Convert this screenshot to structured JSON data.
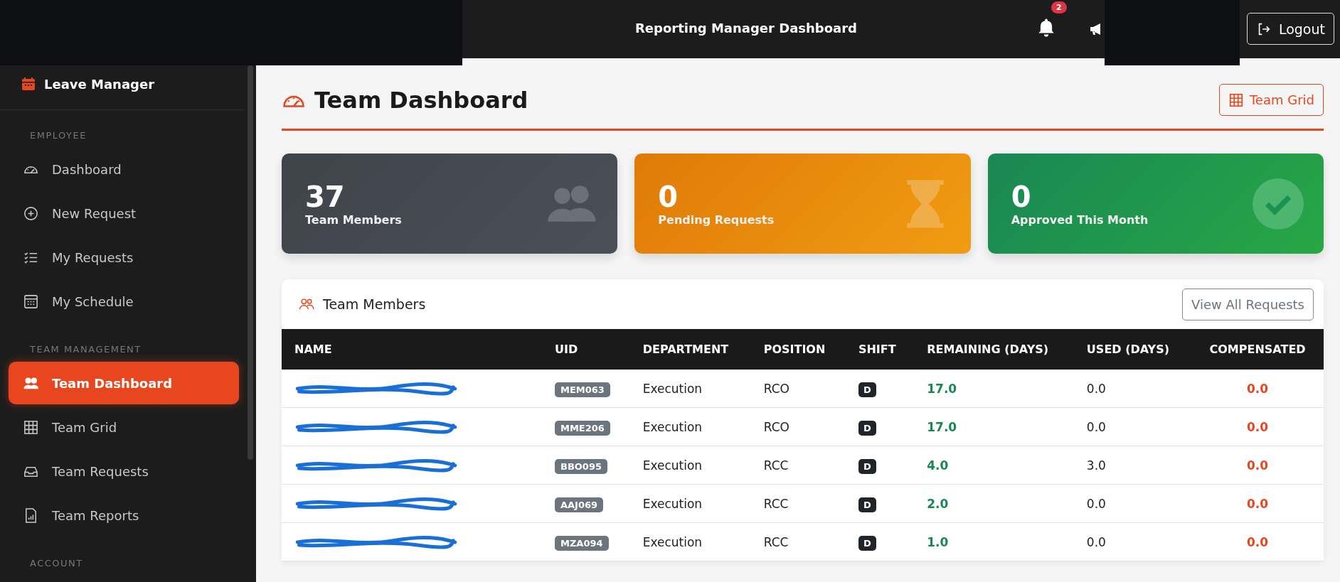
{
  "topbar": {
    "title": "Reporting Manager Dashboard",
    "notification_count": "2",
    "logout": "Logout"
  },
  "sidebar": {
    "brand": "Leave Manager",
    "sections": [
      {
        "heading": "EMPLOYEE",
        "items": [
          {
            "label": "Dashboard",
            "kind": "gauge",
            "selected": false
          },
          {
            "label": "New Request",
            "kind": "plus",
            "selected": false
          },
          {
            "label": "My Requests",
            "kind": "list",
            "selected": false
          },
          {
            "label": "My Schedule",
            "kind": "calendar",
            "selected": false
          }
        ]
      },
      {
        "heading": "TEAM MANAGEMENT",
        "items": [
          {
            "label": "Team Dashboard",
            "kind": "people",
            "selected": true
          },
          {
            "label": "Team Grid",
            "kind": "grid",
            "selected": false
          },
          {
            "label": "Team Requests",
            "kind": "inbox",
            "selected": false
          },
          {
            "label": "Team Reports",
            "kind": "report",
            "selected": false
          }
        ]
      },
      {
        "heading": "ACCOUNT"
      }
    ]
  },
  "page": {
    "title": "Team Dashboard",
    "action": "Team Grid"
  },
  "stats": [
    {
      "value": "37",
      "label": "Team Members",
      "kind": "members"
    },
    {
      "value": "0",
      "label": "Pending Requests",
      "kind": "pending"
    },
    {
      "value": "0",
      "label": "Approved This Month",
      "kind": "approved"
    }
  ],
  "team_panel": {
    "title": "Team Members",
    "action": "View All Requests",
    "columns": [
      "NAME",
      "UID",
      "DEPARTMENT",
      "POSITION",
      "SHIFT",
      "REMAINING (DAYS)",
      "USED (DAYS)",
      "COMPENSATED"
    ],
    "rows": [
      {
        "name_redacted": true,
        "uid": "MEM063",
        "department": "Execution",
        "position": "RCO",
        "shift": "D",
        "remaining": "17.0",
        "used": "0.0",
        "compensated": "0.0"
      },
      {
        "name_redacted": true,
        "uid": "MME206",
        "department": "Execution",
        "position": "RCO",
        "shift": "D",
        "remaining": "17.0",
        "used": "0.0",
        "compensated": "0.0"
      },
      {
        "name_redacted": true,
        "uid": "BBO095",
        "department": "Execution",
        "position": "RCC",
        "shift": "D",
        "remaining": "4.0",
        "used": "3.0",
        "compensated": "0.0"
      },
      {
        "name_redacted": true,
        "uid": "AAJ069",
        "department": "Execution",
        "position": "RCC",
        "shift": "D",
        "remaining": "2.0",
        "used": "0.0",
        "compensated": "0.0"
      },
      {
        "name_redacted": true,
        "uid": "MZA094",
        "department": "Execution",
        "position": "RCC",
        "shift": "D",
        "remaining": "1.0",
        "used": "0.0",
        "compensated": "0.0"
      }
    ]
  }
}
